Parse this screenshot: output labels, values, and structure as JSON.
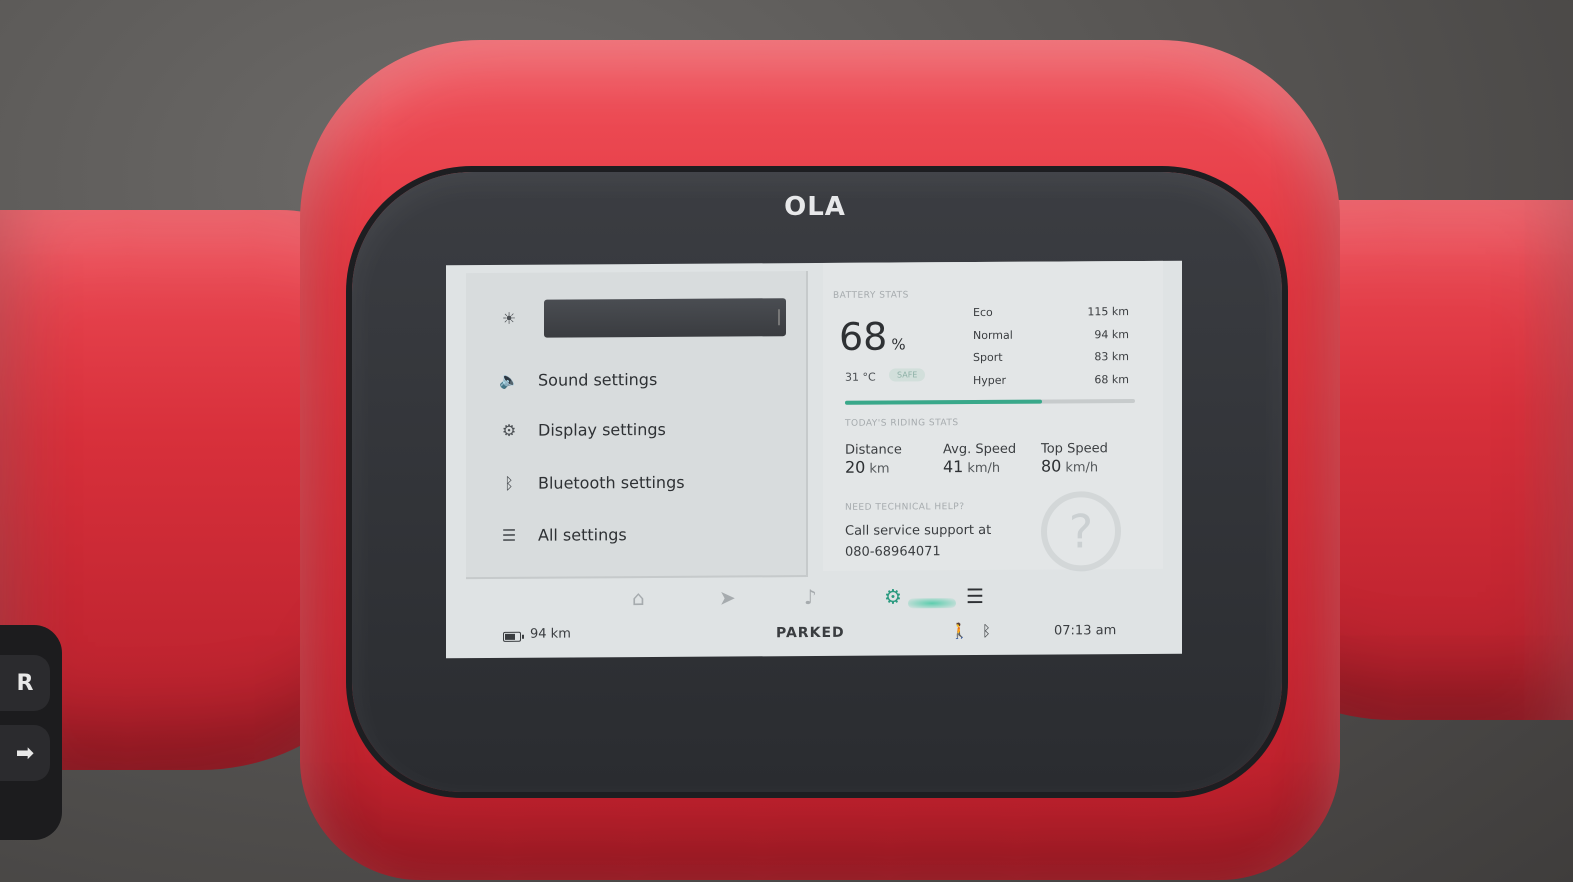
{
  "logo": "OLA",
  "settings_menu": {
    "brightness_level": 1.0,
    "items": [
      {
        "label": "Sound settings",
        "icon": "speaker-icon"
      },
      {
        "label": "Display settings",
        "icon": "gear-icon"
      },
      {
        "label": "Bluetooth settings",
        "icon": "bluetooth-icon"
      },
      {
        "label": "All settings",
        "icon": "list-icon"
      }
    ]
  },
  "battery_stats": {
    "heading": "BATTERY STATS",
    "percent": "68",
    "percent_unit": "%",
    "charge_fraction": 0.68,
    "temperature": "31 °C",
    "temp_status": "SAFE",
    "ranges": [
      {
        "mode": "Eco",
        "range": "115 km"
      },
      {
        "mode": "Normal",
        "range": "94 km"
      },
      {
        "mode": "Sport",
        "range": "83 km"
      },
      {
        "mode": "Hyper",
        "range": "68 km"
      }
    ]
  },
  "riding_stats": {
    "heading": "TODAY'S RIDING STATS",
    "distance": {
      "label": "Distance",
      "value": "20",
      "unit": "km"
    },
    "avg_speed": {
      "label": "Avg. Speed",
      "value": "41",
      "unit": "km/h"
    },
    "top_speed": {
      "label": "Top Speed",
      "value": "80",
      "unit": "km/h"
    }
  },
  "help": {
    "heading": "NEED TECHNICAL HELP?",
    "line1": "Call service support at",
    "phone": "080-68964071",
    "icon": "question-mark-icon"
  },
  "nav": {
    "items": [
      "home-icon",
      "navigation-arrow-icon",
      "music-note-icon",
      "gear-icon",
      "menu-icon"
    ],
    "active": "gear-icon"
  },
  "status_bar": {
    "range": "94 km",
    "state": "PARKED",
    "time": "07:13 am"
  },
  "colors": {
    "accent": "#39a88a",
    "body_red": "#e2353f",
    "screen_bg": "#dfe3e4"
  }
}
